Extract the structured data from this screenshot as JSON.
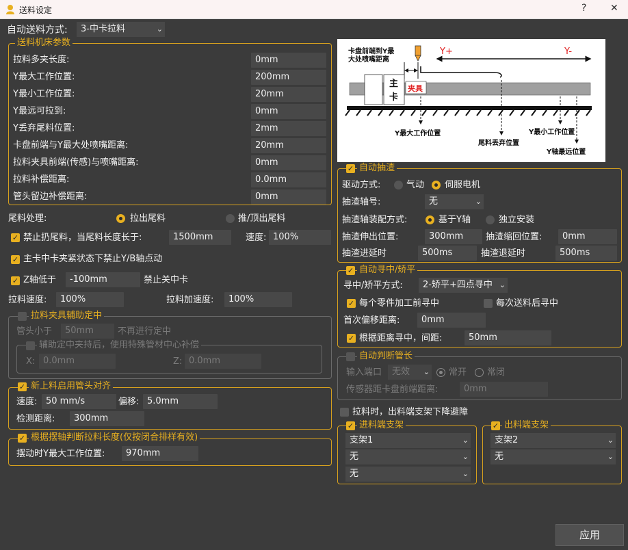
{
  "window": {
    "title": "送料设定",
    "help": "?",
    "close": "✕"
  },
  "auto_mode": {
    "label": "自动送料方式:",
    "value": "3-中卡拉料"
  },
  "machine_params": {
    "title": "送料机床参数",
    "rows": [
      {
        "label": "拉料多夹长度:",
        "value": "0mm"
      },
      {
        "label": "Y最大工作位置:",
        "value": "200mm"
      },
      {
        "label": "Y最小工作位置:",
        "value": "20mm"
      },
      {
        "label": "Y最远可拉到:",
        "value": "0mm"
      },
      {
        "label": "Y丢弃尾料位置:",
        "value": "2mm"
      },
      {
        "label": "卡盘前端与Y最大处喷嘴距离:",
        "value": "20mm"
      },
      {
        "label": "拉料夹具前端(传感)与喷嘴距离:",
        "value": "0mm"
      },
      {
        "label": "拉料补偿距离:",
        "value": "0.0mm"
      },
      {
        "label": "管头留边补偿距离:",
        "value": "0mm"
      }
    ]
  },
  "tail": {
    "label": "尾料处理:",
    "opt1": "拉出尾料",
    "opt2": "推/顶出尾料",
    "forbid_label": "禁止扔尾料，当尾料长度长于:",
    "forbid_value": "1500mm",
    "speed_label": "速度:",
    "speed_value": "100%"
  },
  "chuck_lock_label": "主卡中卡夹紧状态下禁止Y/B轴点动",
  "z_axis": {
    "label": "Z轴低于",
    "value": "-100mm",
    "suffix": "禁止关中卡"
  },
  "pull": {
    "speed_label": "拉料速度:",
    "speed_value": "100%",
    "accel_label": "拉料加速度:",
    "accel_value": "100%"
  },
  "clamp_assist": {
    "title": "拉料夹具辅助定中",
    "pipe_less_label": "管头小于",
    "pipe_less_value": "50mm",
    "pipe_less_suffix": "不再进行定中",
    "sub_title": "辅助定中夹持后，使用特殊管材中心补偿",
    "x_label": "X:",
    "x_value": "0.0mm",
    "z_label": "Z:",
    "z_value": "0.0mm"
  },
  "align": {
    "title": "新上料启用管头对齐",
    "speed_label": "速度:",
    "speed_value": "50 mm/s",
    "offset_label": "偏移:",
    "offset_value": "5.0mm",
    "detect_label": "检测距离:",
    "detect_value": "300mm"
  },
  "swing": {
    "title": "根据摆轴判断拉料长度(仅按闭合排样有效)",
    "label": "摆动时Y最大工作位置:",
    "value": "970mm"
  },
  "diagram": {
    "t1": "卡盘前端到Y最",
    "t2": "大处喷嘴距离",
    "yplus": "Y+",
    "yminus": "Y-",
    "chuck1": "主",
    "chuck2": "卡",
    "clamp": "夹具",
    "ymax": "Y最大工作位置",
    "ymin": "Y最小工作位置",
    "tail": "尾料丢弃位置",
    "yfar": "Y轴最远位置"
  },
  "slag": {
    "title": "自动抽渣",
    "drive_label": "驱动方式:",
    "drive_opt1": "气动",
    "drive_opt2": "伺服电机",
    "axis_label": "抽渣轴号:",
    "axis_value": "无",
    "mount_label": "抽渣轴装配方式:",
    "mount_opt1": "基于Y轴",
    "mount_opt2": "独立安装",
    "extend_label": "抽渣伸出位置:",
    "extend_value": "300mm",
    "retract_label": "抽渣缩回位置:",
    "retract_value": "0mm",
    "in_delay_label": "抽渣进延时",
    "in_delay_value": "500ms",
    "out_delay_label": "抽渣退延时",
    "out_delay_value": "500ms"
  },
  "centering": {
    "title": "自动寻中/矫平",
    "mode_label": "寻中/矫平方式:",
    "mode_value": "2-矫平+四点寻中",
    "each_part": "每个零件加工前寻中",
    "each_feed": "每次送料后寻中",
    "first_offset_label": "首次偏移距离:",
    "first_offset_value": "0mm",
    "by_dist_label": "根据距离寻中，间距:",
    "by_dist_value": "50mm"
  },
  "pipe_len": {
    "title": "自动判断管长",
    "port_label": "输入端口",
    "port_value": "无效",
    "opt1": "常开",
    "opt2": "常闭",
    "sensor_label": "传感器距卡盘前端距离:",
    "sensor_value": "0mm"
  },
  "lower_support_label": "拉料时，出料端支架下降避障",
  "in_support": {
    "title": "进料端支架",
    "items": [
      "支架1",
      "无",
      "无"
    ]
  },
  "out_support": {
    "title": "出料端支架",
    "items": [
      "支架2",
      "无"
    ]
  },
  "apply_label": "应用"
}
